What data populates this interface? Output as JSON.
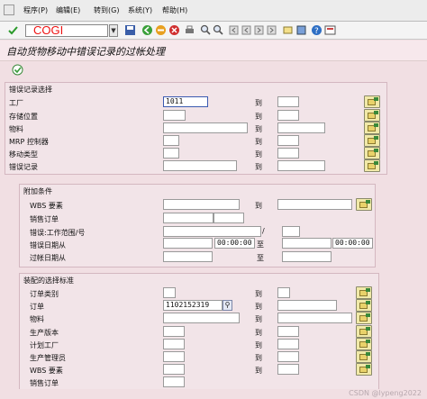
{
  "menu": [
    "程序(P)",
    "编辑(E)",
    "转到(G)",
    "系统(Y)",
    "帮助(H)"
  ],
  "toolbar": {
    "command_value": "COGI",
    "icons": [
      "check-icon",
      "save-icon",
      "back-icon",
      "exit-icon",
      "cancel-icon",
      "print-icon",
      "find-icon",
      "find-next-icon",
      "first-page-icon",
      "prev-page-icon",
      "next-page-icon",
      "last-page-icon",
      "new-session-icon",
      "shortcut-icon",
      "help-icon",
      "layout-icon"
    ]
  },
  "title": "自动货物移动中错误记录的过帐处理",
  "group1": {
    "title": "错误记录选择",
    "rows": [
      {
        "label": "工厂",
        "from": "1011",
        "to_label": "到"
      },
      {
        "label": "存储位置",
        "from": "",
        "to_label": "到"
      },
      {
        "label": "物料",
        "from": "",
        "to_label": "到"
      },
      {
        "label": "MRP 控制器",
        "from": "",
        "to_label": "到"
      },
      {
        "label": "移动类型",
        "from": "",
        "to_label": "到"
      },
      {
        "label": "错误记录",
        "from": "",
        "to_label": "到"
      }
    ]
  },
  "group2": {
    "title": "附加条件",
    "wbs_label": "WBS 要素",
    "wbs_to": "到",
    "sales_label": "销售订单",
    "error_label": "错误:工作范围/号",
    "slash": "/",
    "date_from_label": "错误日期从",
    "time1": "00:00:00",
    "to1": "至",
    "time2": "00:00:00",
    "post_label": "过帐日期从",
    "to2": "至"
  },
  "group3": {
    "title": "装配的选择标准",
    "rows": [
      {
        "label": "订单类别",
        "from": "",
        "to_label": "到"
      },
      {
        "label": "订单",
        "from": "1102152319",
        "to_label": "到"
      },
      {
        "label": "物料",
        "from": "",
        "to_label": "到"
      },
      {
        "label": "生产版本",
        "from": "",
        "to_label": "到"
      },
      {
        "label": "计划工厂",
        "from": "",
        "to_label": "到"
      },
      {
        "label": "生产管理员",
        "from": "",
        "to_label": "到"
      },
      {
        "label": "WBS 要素",
        "from": "",
        "to_label": "到"
      },
      {
        "label": "销售订单",
        "from": "",
        "to_label": ""
      }
    ]
  },
  "watermark": "CSDN @lypeng2022"
}
